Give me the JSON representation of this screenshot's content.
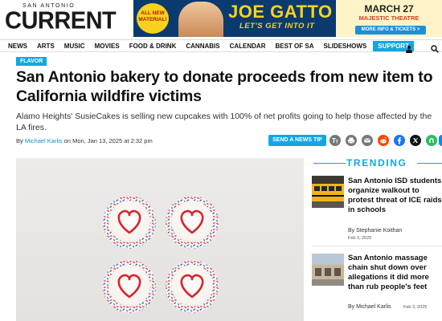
{
  "logo": {
    "small": "SAN ANTONIO",
    "big": "CURRENT"
  },
  "ad": {
    "badge": "ALL NEW MATERIAL!",
    "title": "JOE GATTO",
    "subtitle": "LET'S GET INTO IT",
    "date": "MARCH 27",
    "venue": "MAJESTIC THEATRE",
    "cta": "MORE INFO & TICKETS >"
  },
  "nav": {
    "items": [
      "NEWS",
      "ARTS",
      "MUSIC",
      "MOVIES",
      "FOOD & DRINK",
      "CANNABIS",
      "CALENDAR",
      "BEST OF SA",
      "SLIDESHOWS"
    ],
    "support": "SUPPORT",
    "icons": [
      "user-icon",
      "search-icon"
    ]
  },
  "article": {
    "tag": "FLAVOR",
    "headline": "San Antonio bakery to donate proceeds from new item to California wildfire victims",
    "dek": "Alamo Heights' SusieCakes is selling new cupcakes with 100% of net profits going to help those affected by the LA fires.",
    "byline_prefix": "By",
    "author": "Michael Karlis",
    "date_text": "on Mon, Jan 13, 2025 at 2:32 pm",
    "send_tip": "SEND A NEWS TIP",
    "share_icons": [
      "text-size-icon",
      "print-icon",
      "email-icon",
      "reddit-icon",
      "facebook-icon",
      "x-icon",
      "nextdoor-icon",
      "bluesky-icon"
    ]
  },
  "hero": {
    "subject": "four frosted cupcakes with red heart piping and red white blue sprinkles",
    "accent_colors": {
      "heart": "#d9232e",
      "sprinkle_red": "#d9232e",
      "sprinkle_blue": "#2b5bbf",
      "frosting": "#faf7f3"
    }
  },
  "trending": {
    "title": "TRENDING",
    "items": [
      {
        "title": "San Antonio ISD students organize walkout to protest threat of ICE raids in schools",
        "author": "By Stephanie Koithan",
        "date": "Feb 3, 2025"
      },
      {
        "title": "San Antonio massage chain shut down over allegations it did more than rub people's feet",
        "author": "By Michael Karlis",
        "date": "Feb 3, 2025"
      }
    ]
  },
  "colors": {
    "accent": "#14a6e2",
    "text": "#111111",
    "link": "#1a8ed0"
  }
}
